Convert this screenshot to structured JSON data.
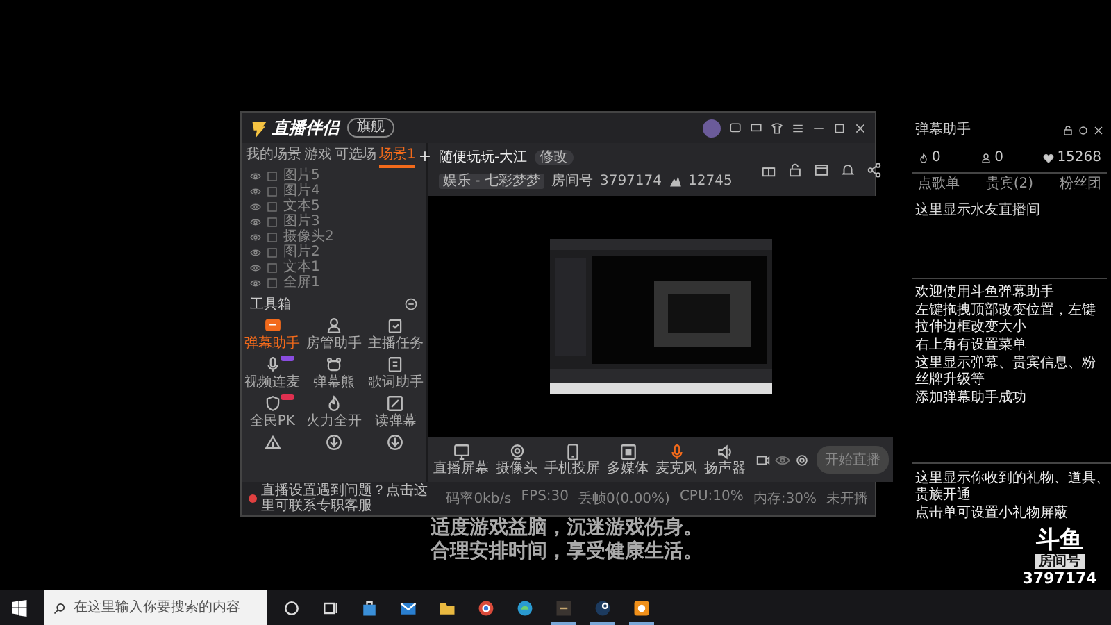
{
  "app": {
    "title": "直播伴侣",
    "badge": "旗舰",
    "scene_tabs": [
      {
        "label": "我的场景",
        "selected": false
      },
      {
        "label": "游戏",
        "selected": false
      },
      {
        "label": "可选场",
        "selected": false
      },
      {
        "label": "场景1",
        "selected": true
      }
    ],
    "add_scene": "+",
    "sources": [
      "图片5",
      "图片4",
      "文本5",
      "图片3",
      "摄像头2",
      "图片2",
      "文本1",
      "全屏1"
    ],
    "stream": {
      "title": "随便玩玩-大江",
      "edit": "修改",
      "category": "娱乐 - 七彩梦梦",
      "room_label": "房间号",
      "room": "3797174",
      "heat": "12745"
    },
    "toolbox": {
      "title": "工具箱",
      "tools": [
        {
          "label": "弹幕助手",
          "kind": "danmu",
          "active": true
        },
        {
          "label": "房管助手",
          "kind": "user",
          "active": false
        },
        {
          "label": "主播任务",
          "kind": "task",
          "active": false
        },
        {
          "label": "视频连麦",
          "kind": "mic",
          "active": false
        },
        {
          "label": "弹幕熊",
          "kind": "bear",
          "active": false
        },
        {
          "label": "歌词助手",
          "kind": "lyrics",
          "active": false
        },
        {
          "label": "全民PK",
          "kind": "pk",
          "active": false
        },
        {
          "label": "火力全开",
          "kind": "fire",
          "active": false
        },
        {
          "label": "读弹幕",
          "kind": "read",
          "active": false
        },
        {
          "kind": "tent"
        },
        {
          "kind": "download"
        },
        {
          "kind": "download"
        }
      ]
    },
    "controls": [
      {
        "label": "直播屏幕",
        "kind": "screen"
      },
      {
        "label": "摄像头",
        "kind": "camera"
      },
      {
        "label": "手机投屏",
        "kind": "phone"
      },
      {
        "label": "多媒体",
        "kind": "media"
      },
      {
        "label": "麦克风",
        "kind": "mic"
      },
      {
        "label": "扬声器",
        "kind": "speaker"
      }
    ],
    "start_button": "开始直播",
    "notice": "直播设置遇到问题？点击这里可联系专职客服",
    "status": [
      "码率0kb/s",
      "FPS:30",
      "丢帧0(0.00%)",
      "CPU:10%",
      "内存:30%",
      "未开播"
    ]
  },
  "danmu_panel": {
    "title": "弹幕助手",
    "stats": [
      {
        "kind": "fire",
        "value": "0"
      },
      {
        "kind": "user",
        "value": "0"
      },
      {
        "kind": "heart",
        "value": "15268"
      }
    ],
    "tabs": [
      "点歌单",
      "贵宾(2)",
      "粉丝团"
    ],
    "hint": "这里显示水友直播间",
    "messages": [
      "欢迎使用斗鱼弹幕助手",
      "左键拖拽顶部改变位置，左键拉伸边框改变大小",
      "右上角有设置菜单",
      "这里显示弹幕、贵宾信息、粉丝牌升级等",
      "添加弹幕助手成功"
    ]
  },
  "gift_panel": {
    "messages": [
      "这里显示你收到的礼物、道具、贵族开通",
      "点击单可设置小礼物屏蔽"
    ]
  },
  "logo": {
    "name": "斗鱼",
    "room_label": "房间号",
    "room": "3797174"
  },
  "health_notice": [
    "适度游戏益脑，沉迷游戏伤身。",
    "合理安排时间，享受健康生活。"
  ],
  "taskbar": {
    "search": {
      "placeholder": "在这里输入你要搜索的内容"
    },
    "apps": [
      {
        "kind": "cortana"
      },
      {
        "kind": "taskview"
      },
      {
        "kind": "store"
      },
      {
        "kind": "mail"
      },
      {
        "kind": "folder"
      },
      {
        "kind": "chrome"
      },
      {
        "kind": "edge"
      },
      {
        "kind": "game",
        "running": true
      },
      {
        "kind": "steam",
        "running": true
      },
      {
        "kind": "douyu",
        "running": true
      }
    ]
  }
}
